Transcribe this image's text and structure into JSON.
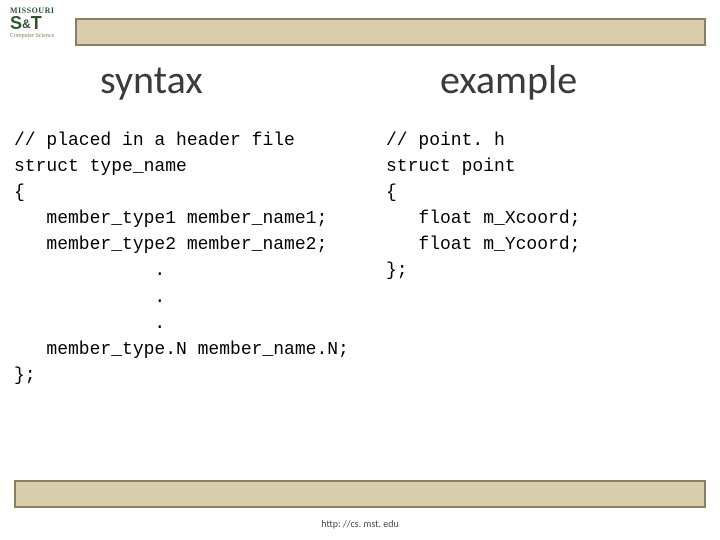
{
  "logo": {
    "top": "MISSOURI",
    "main": "S&T",
    "sub": "Computer Science"
  },
  "headings": {
    "left": "syntax",
    "right": "example"
  },
  "code": {
    "syntax": "// placed in a header file\nstruct type_name\n{\n   member_type1 member_name1;\n   member_type2 member_name2;\n             .\n             .\n             .\n   member_type.N member_name.N;\n};",
    "example": "// point. h\nstruct point\n{\n   float m_Xcoord;\n   float m_Ycoord;\n};"
  },
  "footer": {
    "url": "http: //cs. mst. edu"
  }
}
